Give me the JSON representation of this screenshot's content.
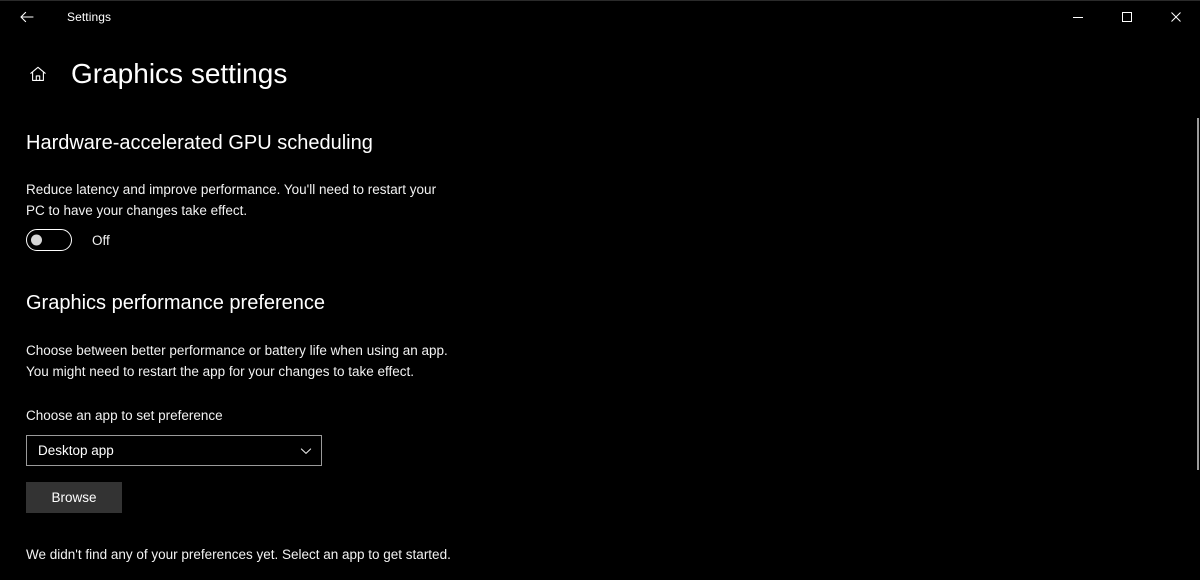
{
  "window": {
    "app_title": "Settings",
    "back_icon": "arrow-left-icon",
    "controls": {
      "minimize": "minimize-icon",
      "maximize": "maximize-icon",
      "close": "close-icon"
    }
  },
  "page": {
    "home_icon": "home-icon",
    "title": "Graphics settings"
  },
  "sections": {
    "gpu_scheduling": {
      "heading": "Hardware-accelerated GPU scheduling",
      "description": "Reduce latency and improve performance. You'll need to restart your\nPC to have your changes take effect.",
      "toggle": {
        "state": "Off",
        "checked": false
      }
    },
    "graphics_performance": {
      "heading": "Graphics performance preference",
      "description": "Choose between better performance or battery life when using an app.\nYou might need to restart the app for your changes to take effect.",
      "choose_app_label": "Choose an app to set preference",
      "app_select": {
        "value": "Desktop app",
        "chevron_icon": "chevron-down-icon"
      },
      "browse_label": "Browse",
      "empty_state": "We didn't find any of your preferences yet. Select an app to get started."
    }
  },
  "colors": {
    "background": "#000000",
    "text": "#ffffff",
    "button_fill": "#333333",
    "select_border": "#9a9a9a",
    "scrollbar_thumb": "#9b9b9b"
  }
}
